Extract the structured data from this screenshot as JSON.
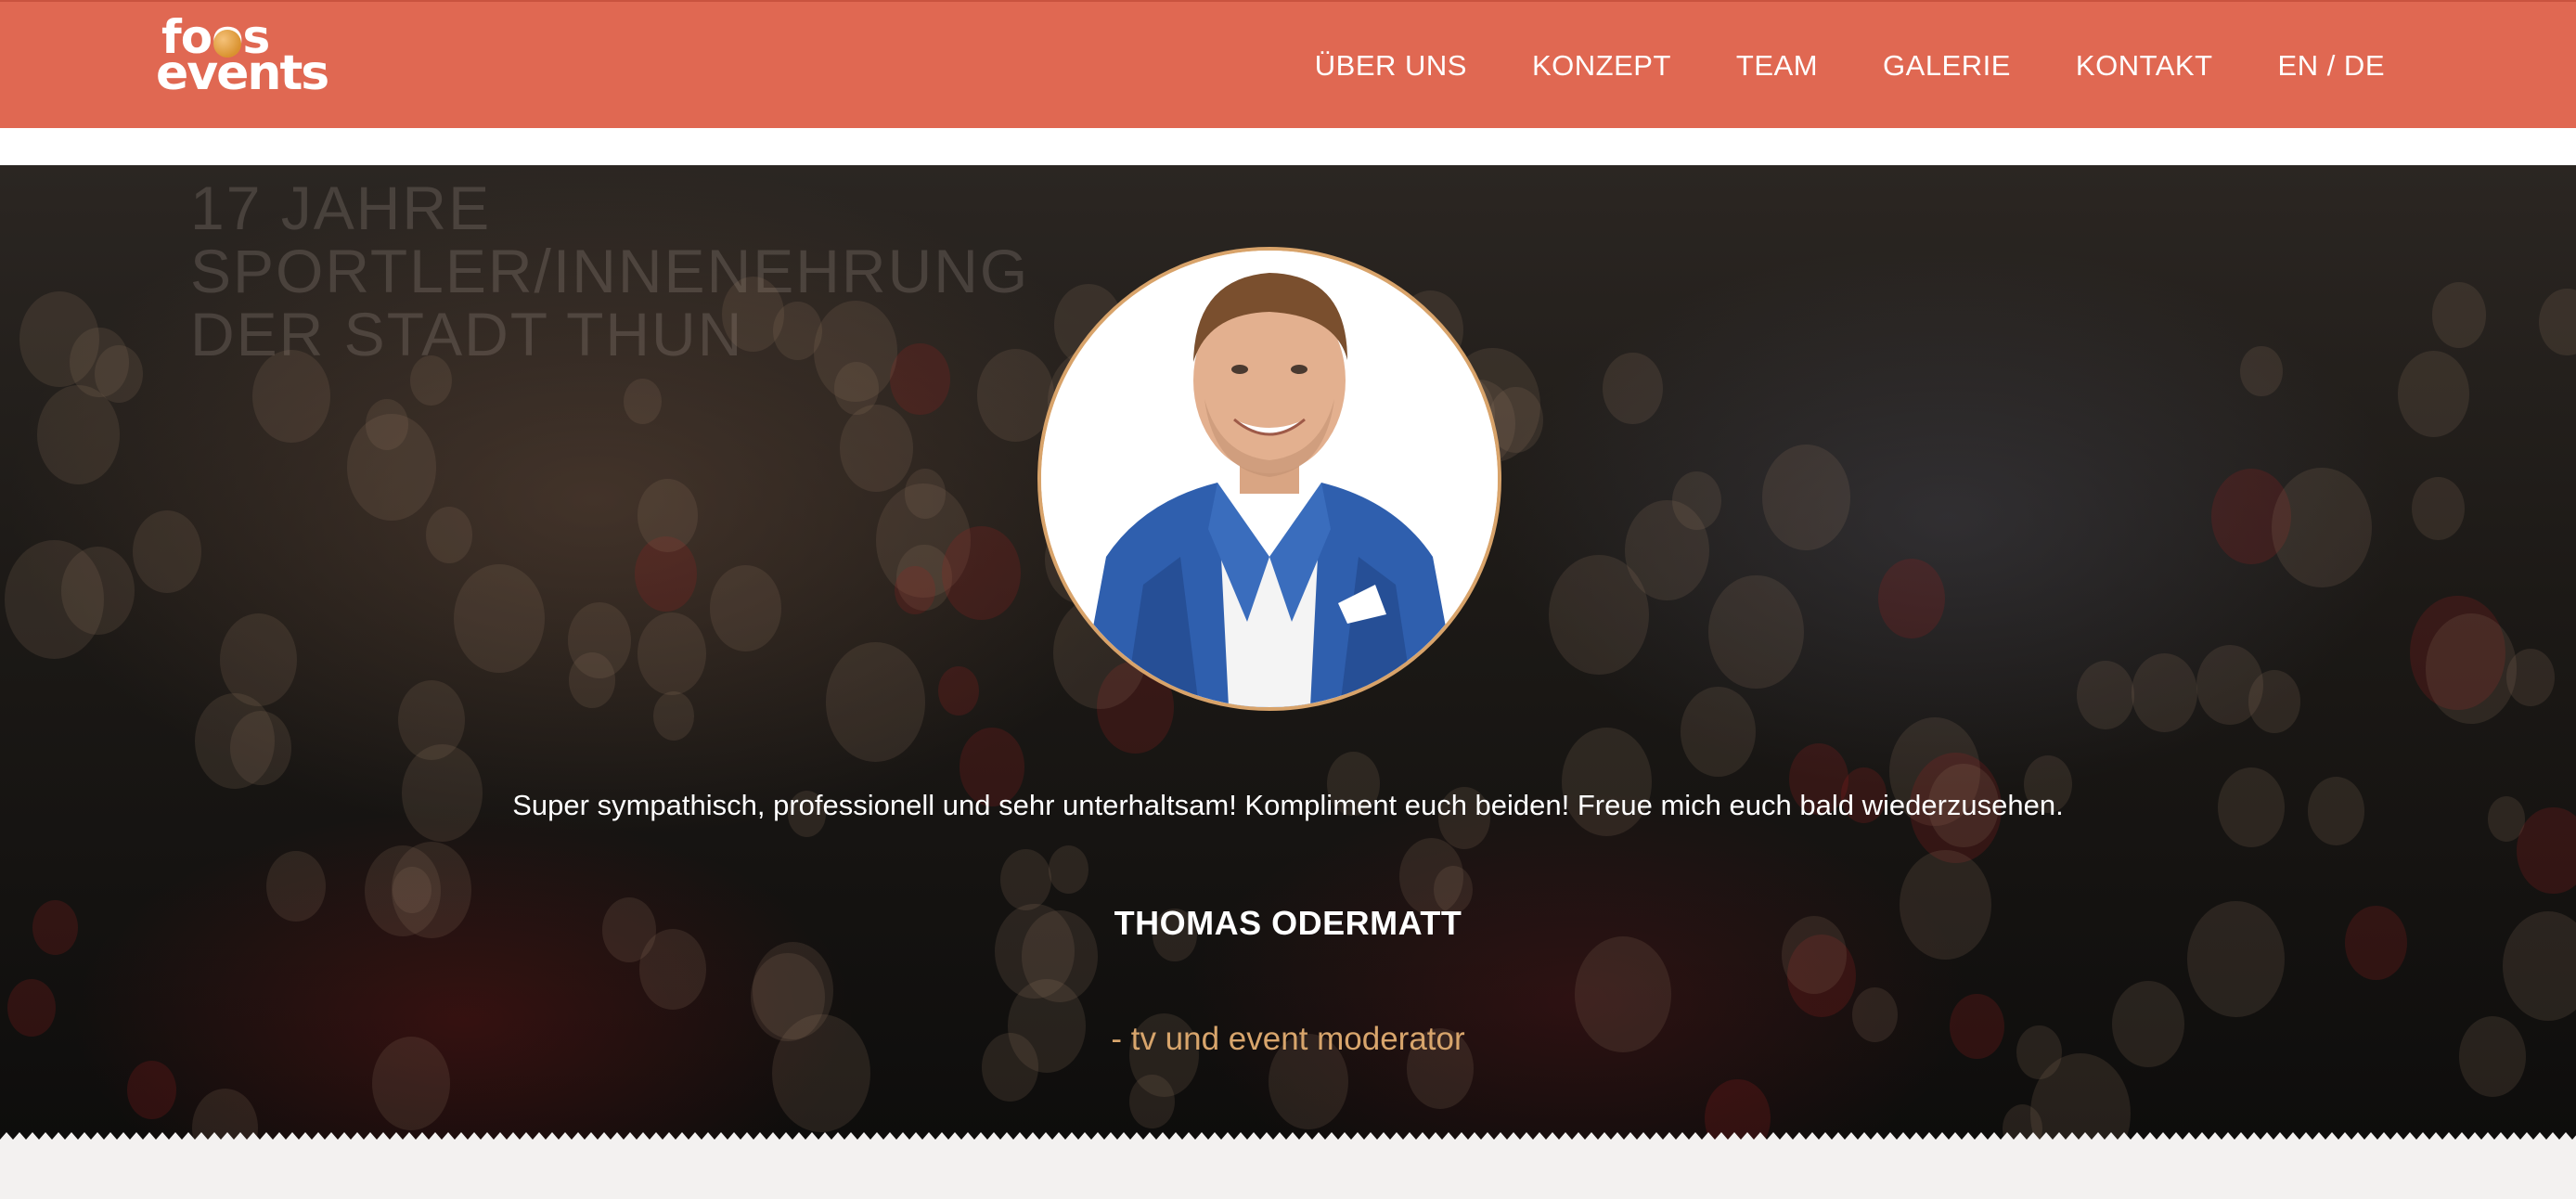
{
  "header": {
    "logo": {
      "line1": "foos",
      "line2": "events"
    },
    "nav": [
      {
        "label": "ÜBER UNS"
      },
      {
        "label": "KONZEPT"
      },
      {
        "label": "TEAM"
      },
      {
        "label": "GALERIE"
      },
      {
        "label": "KONTAKT"
      },
      {
        "label": "EN / DE"
      }
    ]
  },
  "hero": {
    "background_banner": [
      "17 JAHRE",
      "SPORTLER/INNENEHRUNG",
      "DER STADT THUN"
    ],
    "testimonial": {
      "quote": "Super sympathisch, professionell und sehr unterhaltsam! Kompliment euch beiden! Freue mich euch bald wiederzusehen.",
      "author": "THOMAS ODERMATT",
      "role": "- tv und event moderator"
    }
  },
  "colors": {
    "header_bg": "#e06852",
    "accent_gold": "#d8a56c",
    "bottom_band": "#f3f1f0"
  }
}
